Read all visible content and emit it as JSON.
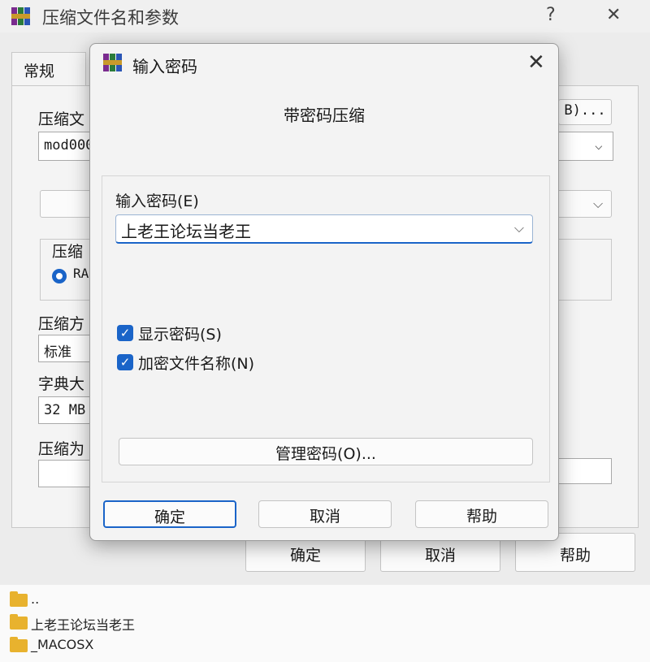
{
  "parent_window": {
    "title": "压缩文件名和参数",
    "help_glyph": "?",
    "close_glyph": "✕",
    "tab_general": "常规",
    "archive_name_label": "压缩文",
    "archive_name_value": "mod000",
    "browse_button_fragment": "B)...",
    "format_group_label": "压缩",
    "format_rar_fragment": "RA",
    "method_label": "压缩方",
    "method_value": "标准",
    "dict_label": "字典大",
    "dict_value": "32 MB",
    "split_label": "压缩为",
    "ok_label": "确定",
    "cancel_label": "取消",
    "help_label": "帮助"
  },
  "password_dialog": {
    "title": "输入密码",
    "close_glyph": "✕",
    "heading": "带密码压缩",
    "password_label": "输入密码(E)",
    "password_value": "上老王论坛当老王",
    "show_password_label": "显示密码(S)",
    "show_password_checked": true,
    "encrypt_names_label": "加密文件名称(N)",
    "encrypt_names_checked": true,
    "manage_button": "管理密码(O)...",
    "ok_label": "确定",
    "cancel_label": "取消",
    "help_label": "帮助"
  },
  "file_list": {
    "items": [
      {
        "name": "..",
        "icon": "folder-icon"
      },
      {
        "name": "上老王论坛当老王",
        "icon": "folder-icon"
      },
      {
        "name": "_MACOSX",
        "icon": "folder-icon"
      }
    ]
  },
  "colors": {
    "accent": "#1a64c8",
    "folder": "#e8b22e"
  }
}
